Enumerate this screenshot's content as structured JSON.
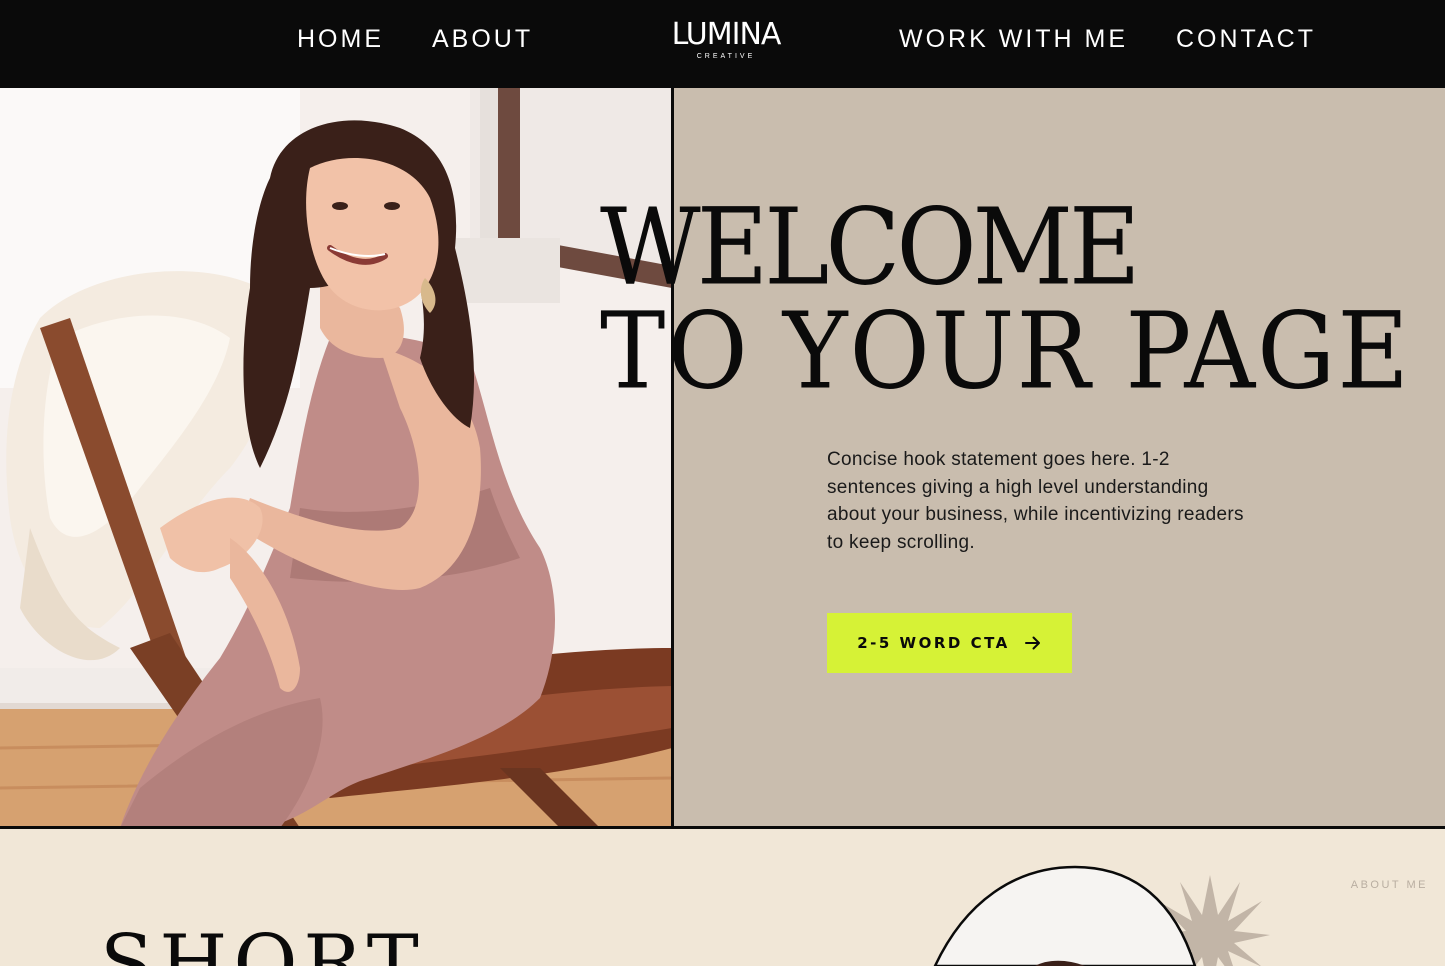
{
  "nav": {
    "home": "HOME",
    "about": "ABOUT",
    "logo": "LUMINA",
    "logo_sub": "CREATIVE",
    "work": "WORK WITH ME",
    "contact": "CONTACT"
  },
  "hero": {
    "headline_line1": "WELCOME",
    "headline_line2": "TO YOUR PAGE",
    "hook": "Concise hook statement goes here. 1-2 sentences giving a high level understanding about your business, while incentivizing readers to keep scrolling.",
    "cta_label": "2-5 WORD CTA",
    "cta_icon": "arrow-right-icon",
    "photo": "woman-seated-on-wooden-chair"
  },
  "about": {
    "tag": "ABOUT ME",
    "title": "SHORT"
  },
  "colors": {
    "nav_bg": "#0a0a0a",
    "hero_panel": "#c9bdae",
    "cta_bg": "#d6f236",
    "section_bg": "#f1e7d7"
  }
}
